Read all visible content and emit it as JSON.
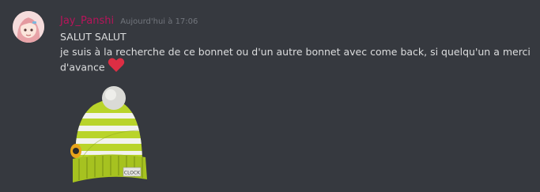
{
  "message": {
    "author": "Jay_Panshi",
    "timestamp": "Aujourd'hui à 17:06",
    "line1": "SALUT SALUT",
    "line2": "je suis à la recherche de ce bonnet ou d'un autre bonnet avec come back, si quelqu'un a merci",
    "line3": "d'avance",
    "emoji": "heart-emoji"
  },
  "colors": {
    "background": "#36393f",
    "username": "#b7145a",
    "timestamp": "#72767d",
    "text": "#dcddde",
    "heart": "#dd2e44"
  },
  "attachment": {
    "type": "image",
    "subject": "lime-green striped beanie with pompom",
    "tag_text": "CLOCK"
  }
}
